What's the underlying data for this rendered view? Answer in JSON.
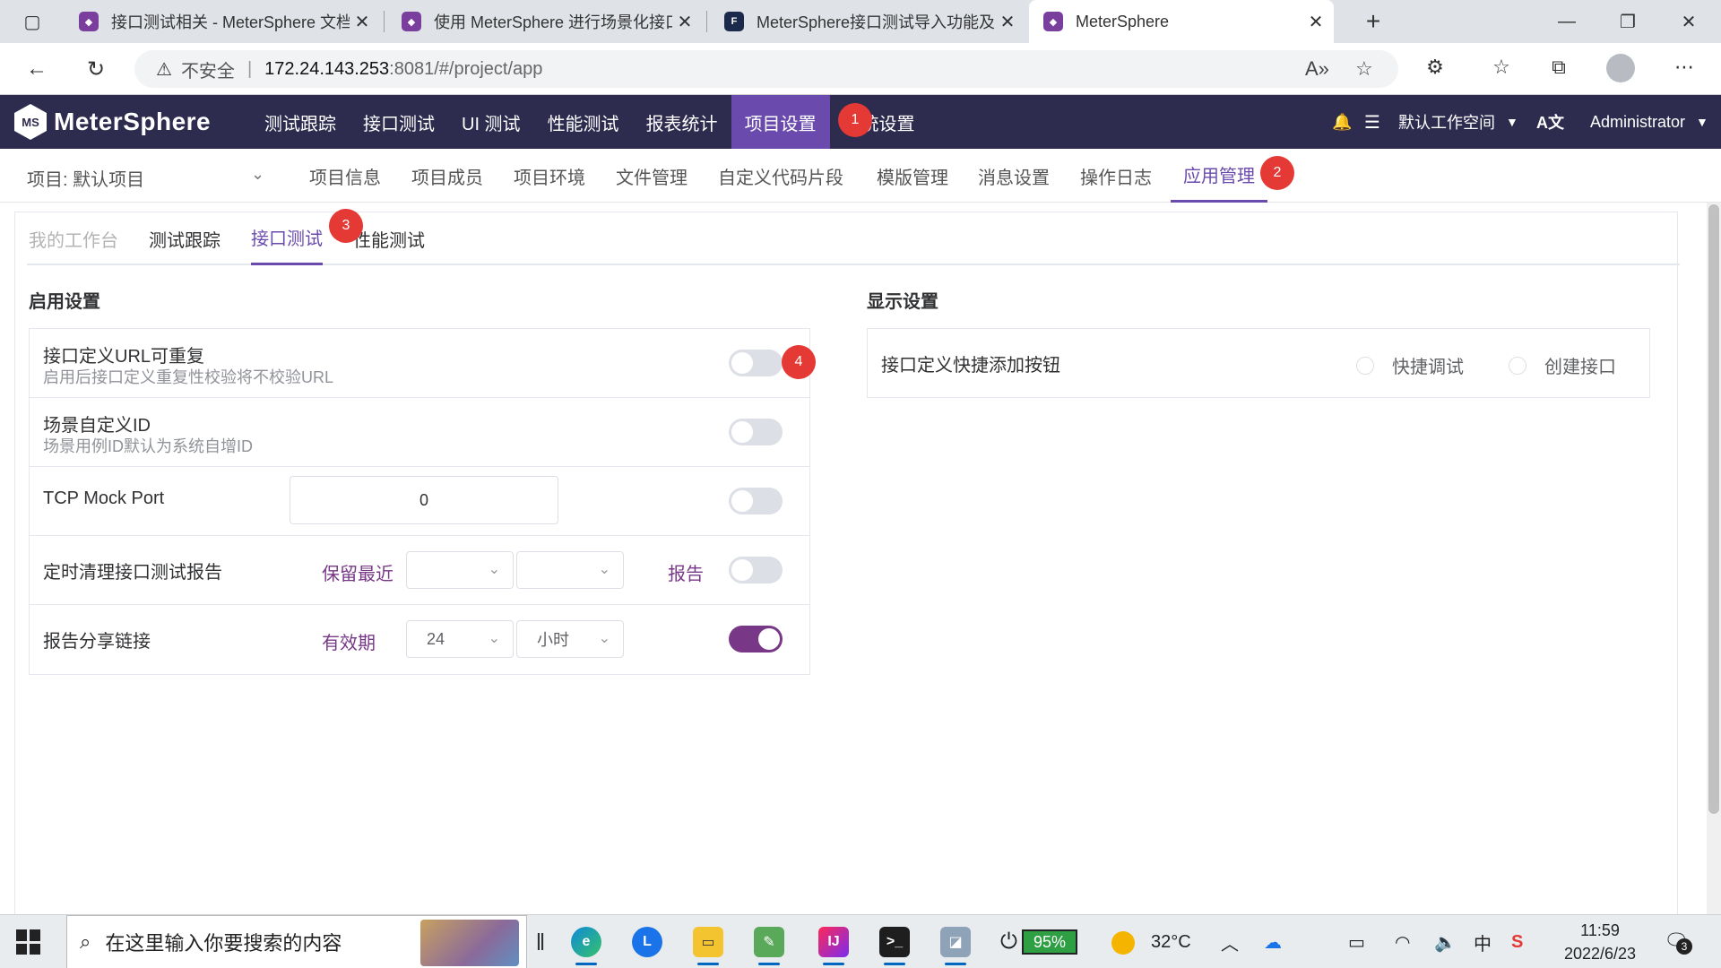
{
  "browser": {
    "tabs": [
      {
        "title": "接口测试相关 - MeterSphere 文档",
        "icon": "metersphere-icon"
      },
      {
        "title": "使用 MeterSphere 进行场景化接口测试",
        "icon": "metersphere-icon"
      },
      {
        "title": "MeterSphere接口测试导入功能及",
        "icon": "f2c-icon"
      },
      {
        "title": "MeterSphere",
        "icon": "metersphere-icon"
      }
    ],
    "url_insecure_label": "不安全",
    "url_host": "172.24.143.253",
    "url_path": ":8081/#/project/app"
  },
  "header": {
    "logo_text": "MeterSphere",
    "nav": [
      "测试跟踪",
      "接口测试",
      "UI 测试",
      "性能测试",
      "报表统计",
      "项目设置",
      "系统设置"
    ],
    "active_nav_index": 5,
    "workspace": "默认工作空间",
    "user": "Administrator"
  },
  "badges": [
    "1",
    "2",
    "3",
    "4"
  ],
  "subnav": {
    "project_label": "项目: 默认项目",
    "items": [
      "项目信息",
      "项目成员",
      "项目环境",
      "文件管理",
      "自定义代码片段",
      "模版管理",
      "消息设置",
      "操作日志",
      "应用管理"
    ],
    "active_index": 8
  },
  "inner_tabs": {
    "items": [
      "我的工作台",
      "测试跟踪",
      "接口测试",
      "性能测试"
    ],
    "active_index": 2
  },
  "enable_settings": {
    "title": "启用设置",
    "rows": [
      {
        "label": "接口定义URL可重复",
        "desc": "启用后接口定义重复性校验将不校验URL",
        "enabled": false
      },
      {
        "label": "场景自定义ID",
        "desc": "场景用例ID默认为系统自增ID",
        "enabled": false
      },
      {
        "label": "TCP Mock Port",
        "value": "0",
        "enabled": false
      },
      {
        "label": "定时清理接口测试报告",
        "keep_label": "保留最近",
        "select1": "",
        "select2": "",
        "suffix": "报告",
        "enabled": false
      },
      {
        "label": "报告分享链接",
        "valid_label": "有效期",
        "select1": "24",
        "select2": "小时",
        "enabled": true
      }
    ]
  },
  "display_settings": {
    "title": "显示设置",
    "label": "接口定义快捷添加按钮",
    "options": [
      "快捷调试",
      "创建接口"
    ]
  },
  "taskbar": {
    "search_placeholder": "在这里输入你要搜索的内容",
    "battery": "95%",
    "temperature": "32°C",
    "ime": "中",
    "time": "11:59",
    "date": "2022/6/23",
    "notifications": "3"
  },
  "colors": {
    "header_bg": "#2d2b4e",
    "accent": "#783887",
    "nav_active": "#6a4bad",
    "badge": "#e53935"
  }
}
